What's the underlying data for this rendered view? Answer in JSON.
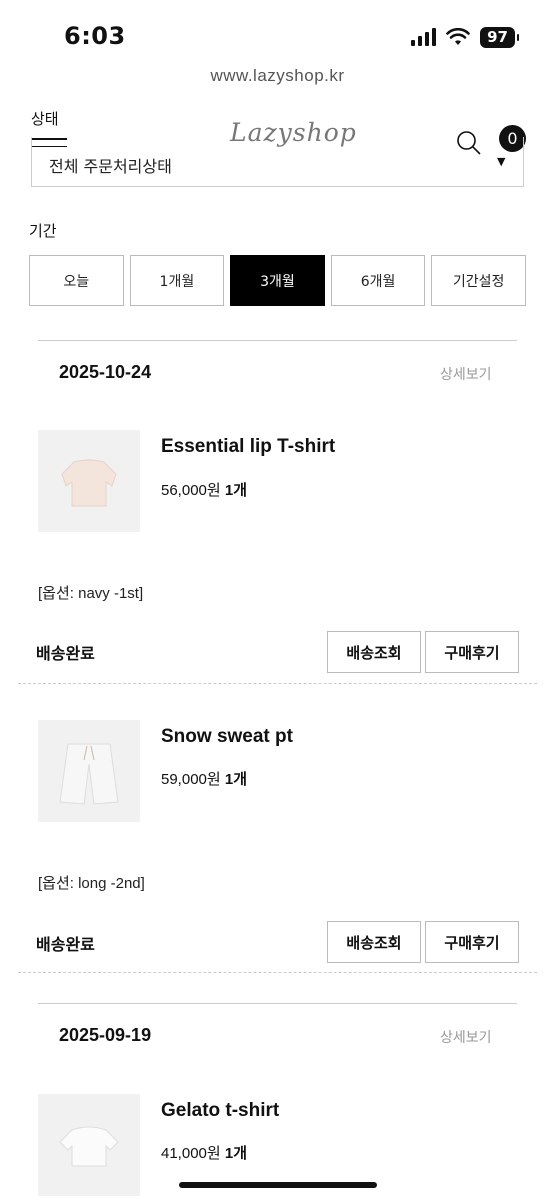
{
  "status_bar": {
    "time": "6:03",
    "battery": "97"
  },
  "browser": {
    "url": "www.lazyshop.kr"
  },
  "header": {
    "status_label": "상태",
    "logo": "Lazyshop",
    "cart_count": "0"
  },
  "filter": {
    "status_value": "전체 주문처리상태",
    "period_label": "기간",
    "periods": [
      "오늘",
      "1개월",
      "3개월",
      "6개월",
      "기간설정"
    ],
    "active_period": "3개월"
  },
  "orders": [
    {
      "date": "2025-10-24",
      "detail_label": "상세보기",
      "items": [
        {
          "name": "Essential lip T-shirt",
          "price": "56,000원",
          "qty": "1개",
          "option": "[옵션: navy -1st]",
          "status": "배송완료",
          "track_label": "배송조회",
          "review_label": "구매후기"
        },
        {
          "name": "Snow sweat pt",
          "price": "59,000원",
          "qty": "1개",
          "option": "[옵션: long -2nd]",
          "status": "배송완료",
          "track_label": "배송조회",
          "review_label": "구매후기"
        }
      ]
    },
    {
      "date": "2025-09-19",
      "detail_label": "상세보기",
      "items": [
        {
          "name": "Gelato t-shirt",
          "price": "41,000원",
          "qty": "1개"
        }
      ]
    }
  ]
}
